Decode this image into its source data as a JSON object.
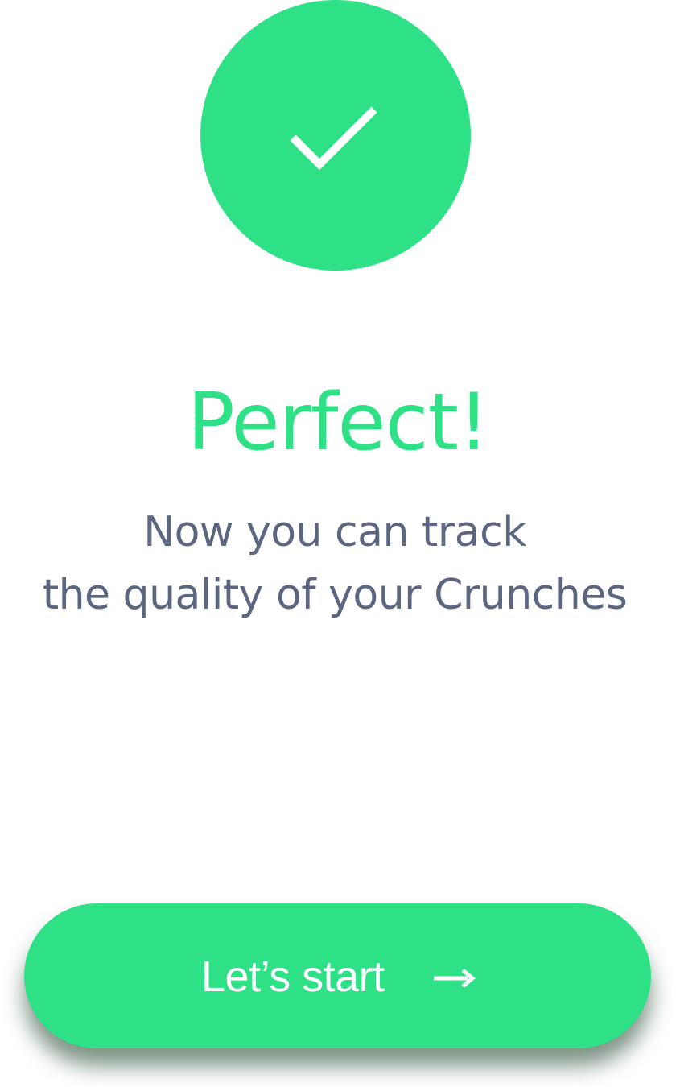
{
  "status": {
    "icon": "checkmark-icon",
    "title": "Perfect!",
    "message_line_1": "Now you can track",
    "message_line_2": "the quality of your Crunches"
  },
  "action": {
    "label": "Let’s start",
    "icon": "arrow-right-icon"
  },
  "colors": {
    "accent": "#2ee086",
    "text": "#5d6680",
    "background": "#ffffff"
  }
}
